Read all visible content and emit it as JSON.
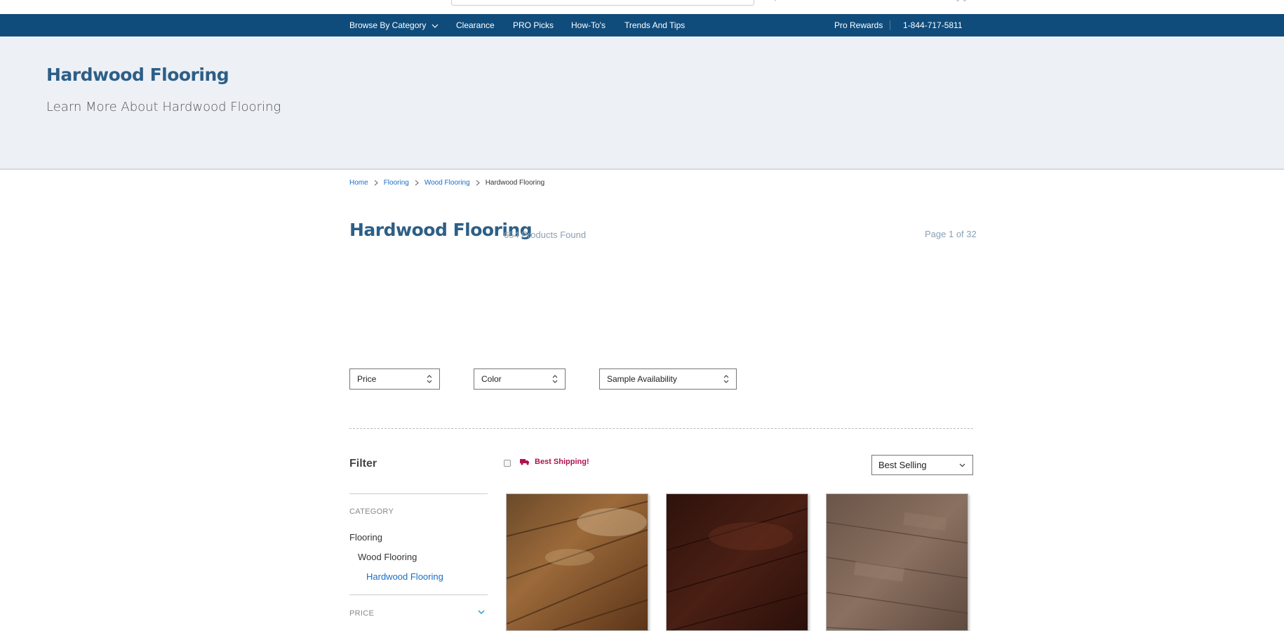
{
  "nav": {
    "items": [
      {
        "label": "Browse By Category"
      },
      {
        "label": "Clearance"
      },
      {
        "label": "PRO Picks"
      },
      {
        "label": "How-To's"
      },
      {
        "label": "Trends And Tips"
      }
    ],
    "pro_rewards": "Pro Rewards",
    "phone": "1-844-717-5811"
  },
  "hero": {
    "title": "Hardwood Flooring",
    "subtitle": "Learn More About Hardwood Flooring"
  },
  "breadcrumb": [
    {
      "label": "Home"
    },
    {
      "label": "Flooring"
    },
    {
      "label": "Wood Flooring"
    },
    {
      "label": "Hardwood Flooring"
    }
  ],
  "results": {
    "title": "Hardwood Flooring",
    "count": "654 Products Found",
    "page": "Page 1 of 32"
  },
  "filters": {
    "price": "Price",
    "color": "Color",
    "sample": "Sample Availability"
  },
  "sidebar": {
    "heading": "Filter",
    "category_label": "CATEGORY",
    "categories": [
      {
        "label": "Flooring"
      },
      {
        "label": "Wood Flooring"
      },
      {
        "label": "Hardwood Flooring"
      }
    ],
    "price_label": "PRICE"
  },
  "toolbar": {
    "shipping_label": "Best Shipping!",
    "sort_value": "Best Selling"
  },
  "colors": {
    "brand_blue": "#0f4c7c",
    "title_blue": "#2d5f86",
    "link_blue": "#1a6fc4",
    "shipping_red": "#b0134f"
  }
}
